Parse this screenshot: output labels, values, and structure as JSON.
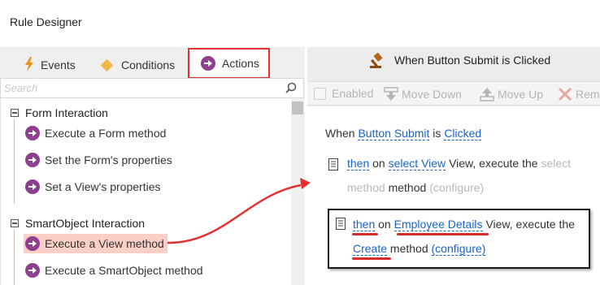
{
  "window": {
    "title": "Rule Designer"
  },
  "tabs": [
    {
      "label": "Events",
      "icon": "lightning-bolt-icon"
    },
    {
      "label": "Conditions",
      "icon": "diamond-icon"
    },
    {
      "label": "Actions",
      "icon": "arrow-circle-icon",
      "active": true
    }
  ],
  "search": {
    "placeholder": "Search",
    "value": ""
  },
  "tree": {
    "groups": [
      {
        "label": "Form Interaction",
        "items": [
          "Execute a Form method",
          "Set the Form's properties",
          "Set a View's properties"
        ]
      },
      {
        "label": "SmartObject Interaction",
        "items": [
          "Execute a View method",
          "Execute a SmartObject method"
        ],
        "selected": "Execute a View method"
      }
    ]
  },
  "rule": {
    "header_title": "When Button Submit is Clicked",
    "toolbar": {
      "enabled_label": "Enabled",
      "move_down_label": "Move Down",
      "move_up_label": "Move Up",
      "remove_label": "Rem"
    },
    "when_line": {
      "prefix": "When",
      "control": "Button Submit",
      "is": "is",
      "event": "Clicked"
    },
    "action1": {
      "then": "then",
      "on": "on",
      "view": "select View",
      "view_suffix": "View, execute the",
      "method_placeholder_a": "select",
      "method_placeholder_b": "method",
      "method_word": "method",
      "configure": "(configure)"
    },
    "action2": {
      "then": "then",
      "on": "on",
      "view": "Employee Details",
      "view_suffix": "View, execute the",
      "method": "Create",
      "method_word": "method",
      "configure": "(configure)"
    }
  },
  "colors": {
    "accent_red": "#e03232",
    "link_blue": "#1a64c8",
    "action_purple": "#8e3f8f",
    "selected_bg": "#f9cfc6",
    "condition_orange": "#f0b84a",
    "event_orange": "#e8952a"
  }
}
